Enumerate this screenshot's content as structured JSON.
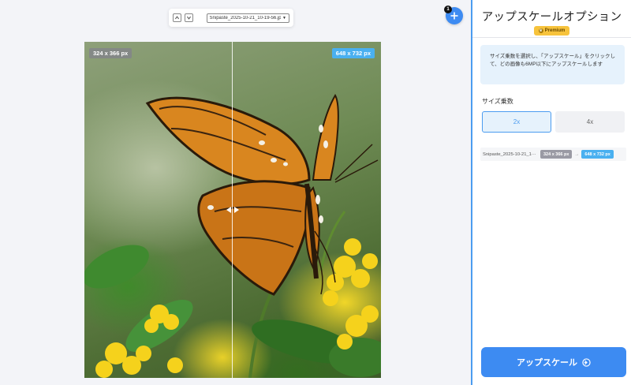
{
  "toolbar": {
    "prev_icon": "chevron-up-icon",
    "next_icon": "chevron-down-icon",
    "file_name": "Snipaste_2025-10-21_10-19-56.jpg"
  },
  "add": {
    "badge_count": "1",
    "icon": "plus-icon"
  },
  "image": {
    "original_size": "324 x 366 px",
    "upscaled_size": "648 x 732 px",
    "divider_position": 0.5
  },
  "panel": {
    "title": "アップスケールオプション",
    "premium_label": "Premium",
    "info_text": "サイズ乗数を選択し、「アップスケール」をクリックして、どの画像も6MP以下にアップスケールします",
    "scale_label": "サイズ乗数",
    "scale_options": [
      {
        "label": "2x",
        "selected": true
      },
      {
        "label": "4x",
        "selected": false
      }
    ],
    "file": {
      "name": "Snipaste_2025-10-21_1···",
      "from": "324 x 366 px",
      "arrow": "→",
      "to": "648 x 732 px"
    },
    "upscale_button": "アップスケール"
  },
  "colors": {
    "accent": "#3d8bf2",
    "tag_blue": "#4ab0f0",
    "premium": "#f7c33c",
    "info_bg": "#e6f2fc"
  }
}
